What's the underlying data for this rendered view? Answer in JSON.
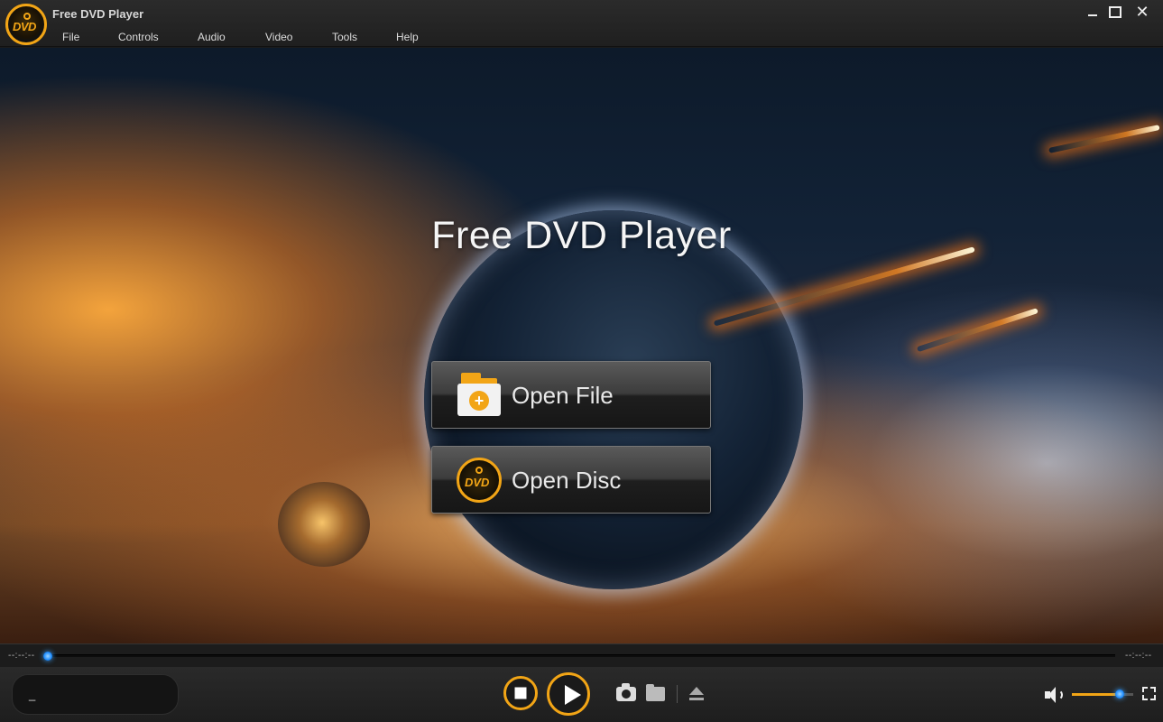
{
  "app": {
    "title": "Free DVD Player",
    "logo_text": "DVD"
  },
  "menu": {
    "file": "File",
    "controls": "Controls",
    "audio": "Audio",
    "video": "Video",
    "tools": "Tools",
    "help": "Help"
  },
  "window_controls": {
    "close_glyph": "✕"
  },
  "stage": {
    "title": "Free DVD Player",
    "open_file_label": "Open File",
    "open_disc_label": "Open Disc",
    "disc_icon_text": "DVD"
  },
  "playback": {
    "elapsed": "--:--:--",
    "remaining": "--:--:--",
    "progress": 0.0
  },
  "info": {
    "text": "_"
  },
  "volume": {
    "level": 0.78
  },
  "colors": {
    "accent": "#f2a516",
    "progress": "#2f9bff"
  }
}
